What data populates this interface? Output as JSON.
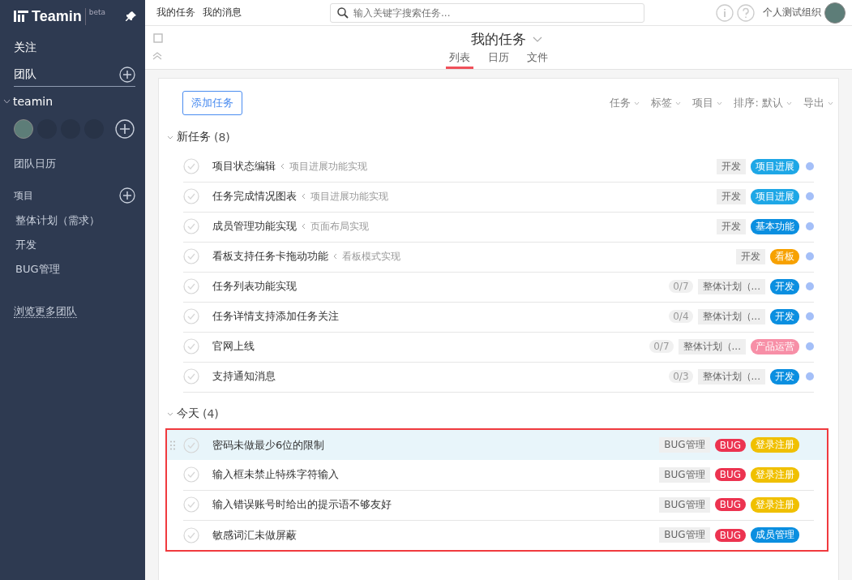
{
  "sidebar": {
    "logo": "Teamin",
    "badge": "beta",
    "follow": "关注",
    "team_header": "团队",
    "team": {
      "name": "teamin",
      "expanded": true
    },
    "team_calendar": "团队日历",
    "projects_header": "项目",
    "projects": [
      "整体计划（需求）",
      "开发",
      "BUG管理"
    ],
    "browse_more": "浏览更多团队"
  },
  "topbar": {
    "links": [
      "我的任务",
      "我的消息"
    ],
    "search": {
      "placeholder": "输入关键字搜索任务..."
    },
    "org": "个人测试组织"
  },
  "header": {
    "title": "我的任务",
    "tabs": [
      {
        "label": "列表",
        "selected": true
      },
      {
        "label": "日历",
        "selected": false
      },
      {
        "label": "文件",
        "selected": false
      }
    ]
  },
  "toolbar": {
    "add_button": "添加任务",
    "filters": [
      "任务",
      "标签",
      "项目",
      "排序: 默认",
      "导出"
    ]
  },
  "groups": [
    {
      "title": "新任务",
      "count": "(8)",
      "highlighted": false,
      "tasks": [
        {
          "title": "项目状态编辑",
          "parent": "项目进展功能实现",
          "project": "开发",
          "tags": [
            {
              "label": "项目进展",
              "color": "#1ea7e6"
            }
          ],
          "dot": true,
          "selected": false
        },
        {
          "title": "任务完成情况图表",
          "parent": "项目进展功能实现",
          "project": "开发",
          "tags": [
            {
              "label": "项目进展",
              "color": "#1ea7e6"
            }
          ],
          "dot": true,
          "selected": false
        },
        {
          "title": "成员管理功能实现",
          "parent": "页面布局实现",
          "project": "开发",
          "tags": [
            {
              "label": "基本功能",
              "color": "#0b8fe0"
            }
          ],
          "dot": true,
          "selected": false
        },
        {
          "title": "看板支持任务卡拖动功能",
          "parent": "看板模式实现",
          "project": "开发",
          "tags": [
            {
              "label": "看板",
              "color": "#f7a100"
            }
          ],
          "dot": true,
          "selected": false
        },
        {
          "title": "任务列表功能实现",
          "progress": "0/7",
          "project": "整体计划（...",
          "tags": [
            {
              "label": "开发",
              "color": "#0b8fe0"
            }
          ],
          "dot": true,
          "selected": false
        },
        {
          "title": "任务详情支持添加任务关注",
          "progress": "0/4",
          "project": "整体计划（...",
          "tags": [
            {
              "label": "开发",
              "color": "#0b8fe0"
            }
          ],
          "dot": true,
          "selected": false
        },
        {
          "title": "官网上线",
          "progress": "0/7",
          "project": "整体计划（...",
          "tags": [
            {
              "label": "产品运营",
              "color": "#f78fa7"
            }
          ],
          "dot": true,
          "selected": false
        },
        {
          "title": "支持通知消息",
          "progress": "0/3",
          "project": "整体计划（...",
          "tags": [
            {
              "label": "开发",
              "color": "#0b8fe0"
            }
          ],
          "dot": true,
          "selected": false
        }
      ]
    },
    {
      "title": "今天",
      "count": "(4)",
      "highlighted": true,
      "tasks": [
        {
          "title": "密码未做最少6位的限制",
          "project": "BUG管理",
          "tags": [
            {
              "label": "BUG",
              "color": "#ec3350"
            },
            {
              "label": "登录注册",
              "color": "#f0c000"
            }
          ],
          "dot": false,
          "selected": true
        },
        {
          "title": "输入框未禁止特殊字符输入",
          "project": "BUG管理",
          "tags": [
            {
              "label": "BUG",
              "color": "#ec3350"
            },
            {
              "label": "登录注册",
              "color": "#f0c000"
            }
          ],
          "dot": false,
          "selected": false
        },
        {
          "title": "输入错误账号时给出的提示语不够友好",
          "project": "BUG管理",
          "tags": [
            {
              "label": "BUG",
              "color": "#ec3350"
            },
            {
              "label": "登录注册",
              "color": "#f0c000"
            }
          ],
          "dot": false,
          "selected": false
        },
        {
          "title": "敏感词汇未做屏蔽",
          "project": "BUG管理",
          "tags": [
            {
              "label": "BUG",
              "color": "#ec3350"
            },
            {
              "label": "成员管理",
              "color": "#0b8fe0"
            }
          ],
          "dot": false,
          "selected": false
        }
      ]
    }
  ]
}
